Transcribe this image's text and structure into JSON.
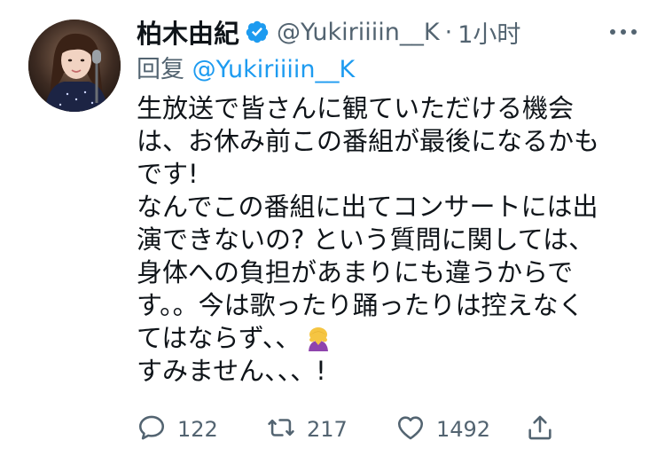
{
  "tweet": {
    "author": {
      "display_name": "柏木由紀",
      "handle": "@Yukiriiiin__K",
      "avatar": "avatar-photo",
      "verified_icon": "verified-badge-icon"
    },
    "separator": "·",
    "time": "1小时",
    "reply_prefix": "回复",
    "reply_handle": "@Yukiriiiin__K",
    "body_lines": [
      "生放送で皆さんに観ていただける機会",
      "は、お休み前この番組が最後になるかも",
      "です!",
      "なんでこの番組に出てコンサートには出",
      "演できないの? という質問に関しては、",
      "身体への負担があまりにも違うからで",
      "す。。今は歌ったり踊ったりは控えなく",
      "てはならず、、",
      "すみません、、、!"
    ],
    "emoji": "person-bowing-emoji",
    "actions": {
      "reply": {
        "icon": "reply-icon",
        "count": "122"
      },
      "retweet": {
        "icon": "retweet-icon",
        "count": "217"
      },
      "like": {
        "icon": "like-icon",
        "count": "1492"
      },
      "share": {
        "icon": "share-icon"
      }
    },
    "colors": {
      "accent": "#1d9bf0",
      "text": "#0f1419",
      "secondary": "#536471"
    }
  }
}
